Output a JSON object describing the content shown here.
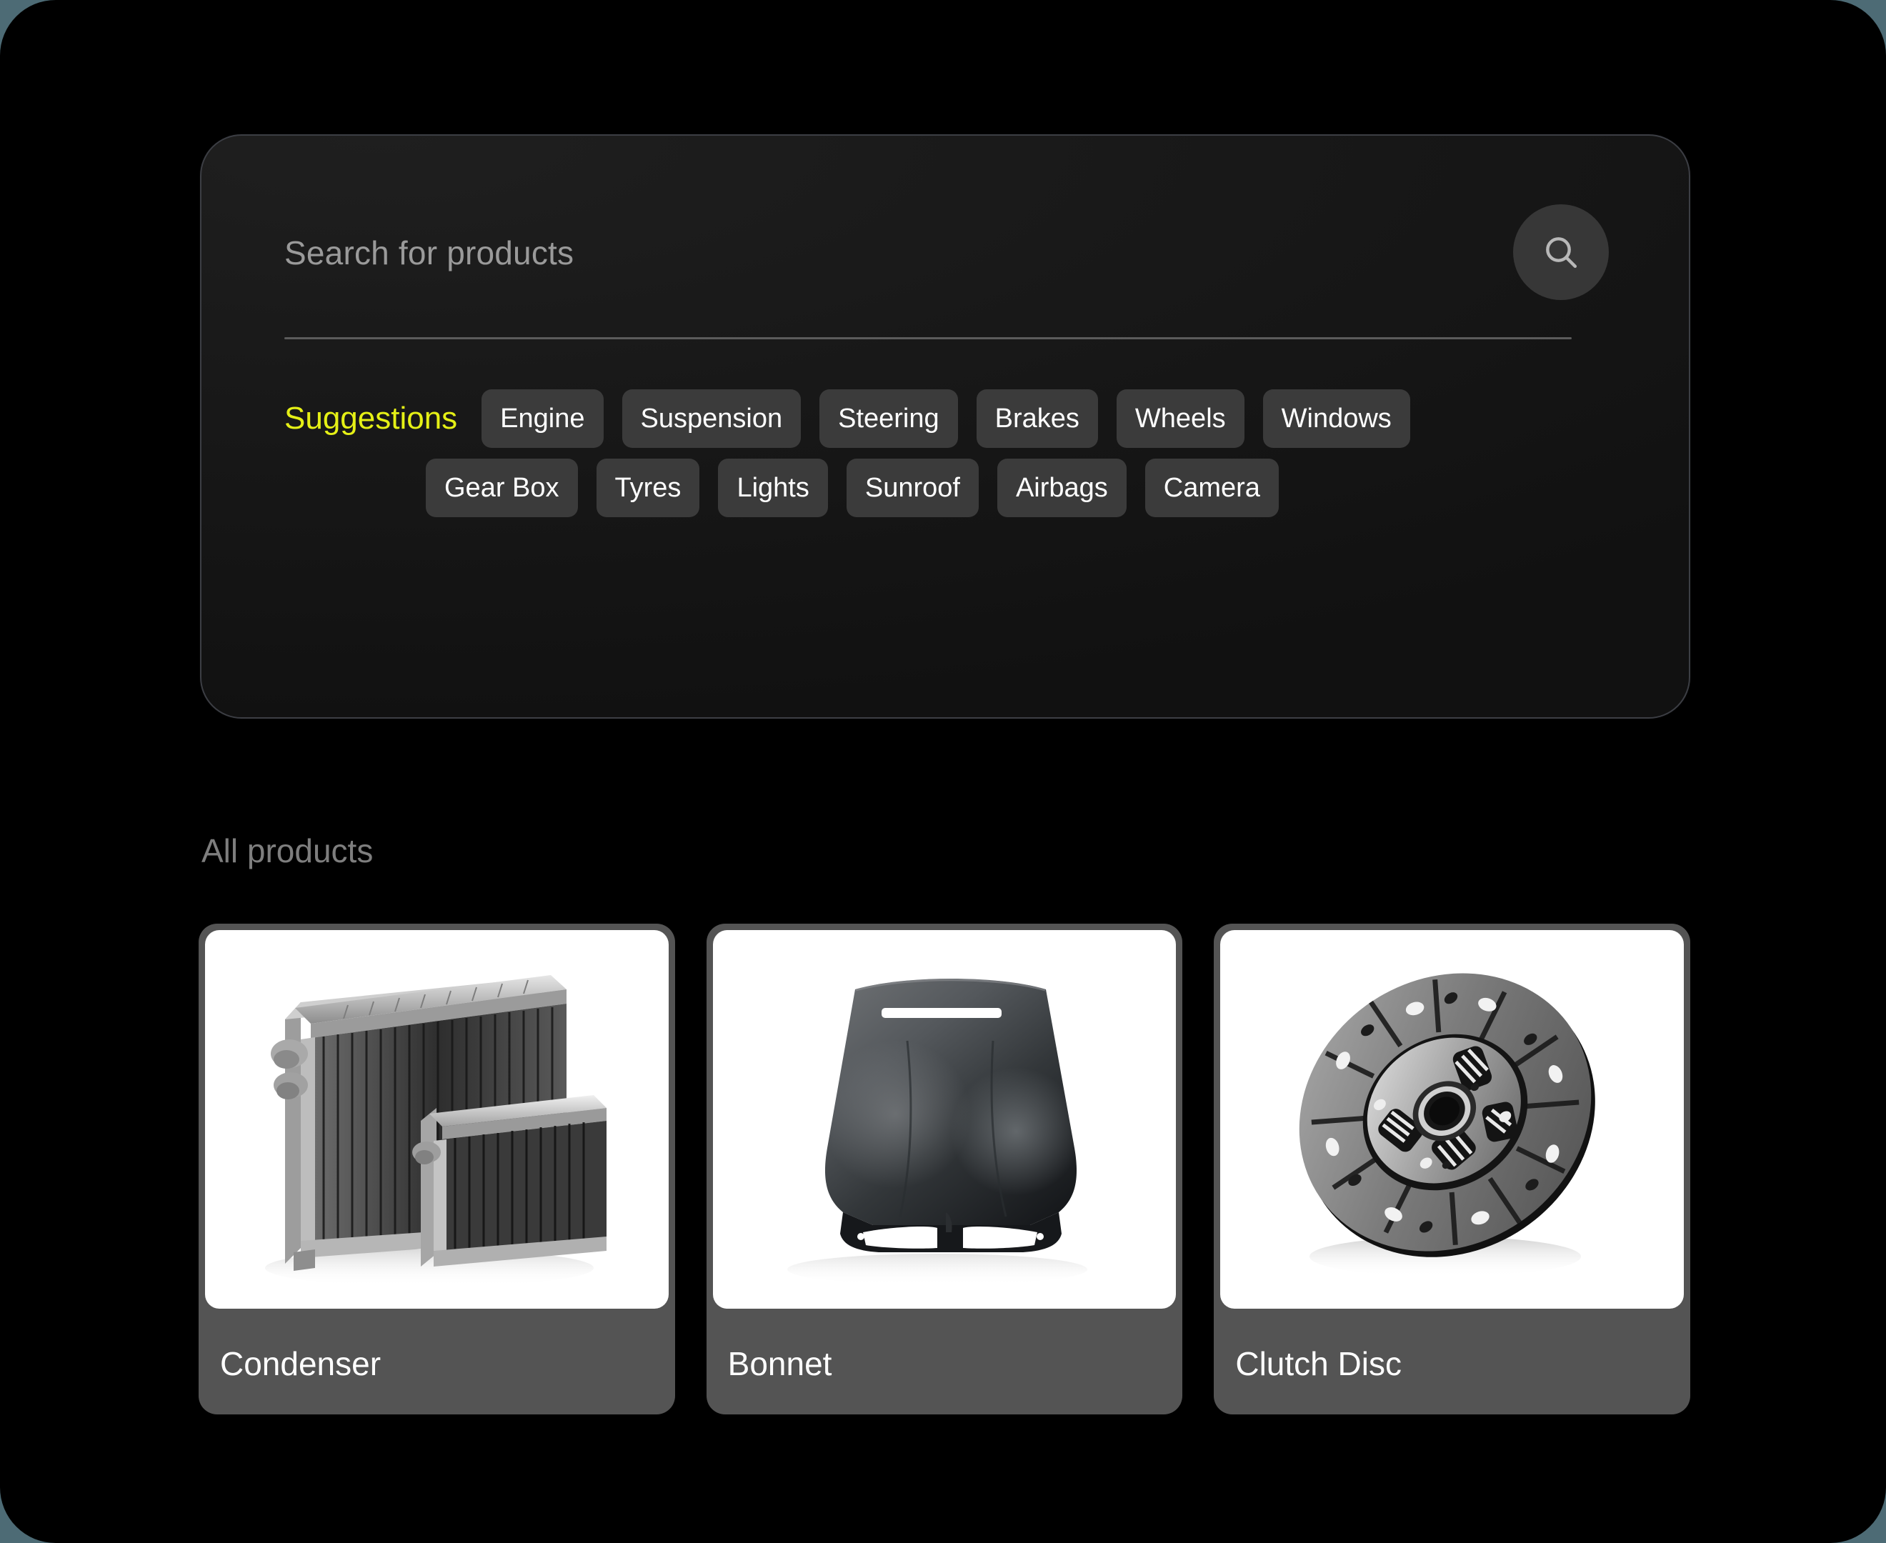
{
  "search": {
    "placeholder": "Search for products",
    "value": "",
    "button_icon": "search-icon"
  },
  "suggestions": {
    "label": "Suggestions",
    "label_color": "#e5f016",
    "row1": [
      "Engine",
      "Suspension",
      "Steering",
      "Brakes",
      "Wheels",
      "Windows"
    ],
    "row2": [
      "Gear Box",
      "Tyres",
      "Lights",
      "Sunroof",
      "Airbags",
      "Camera"
    ]
  },
  "products_section": {
    "title": "All products",
    "items": [
      {
        "name": "Condenser",
        "image": "condenser-photo"
      },
      {
        "name": "Bonnet",
        "image": "bonnet-photo"
      },
      {
        "name": "Clutch Disc",
        "image": "clutch-disc-photo"
      }
    ]
  },
  "theme": {
    "screen_background": "#000000",
    "panel_background": "#171717",
    "panel_border": "#3c3e44",
    "chip_background": "#3b3b3b",
    "chip_text": "#ffffff",
    "card_background": "#545454",
    "muted_text": "#7e7e7e",
    "placeholder_text": "#9a9a9a",
    "accent": "#e5f016"
  }
}
